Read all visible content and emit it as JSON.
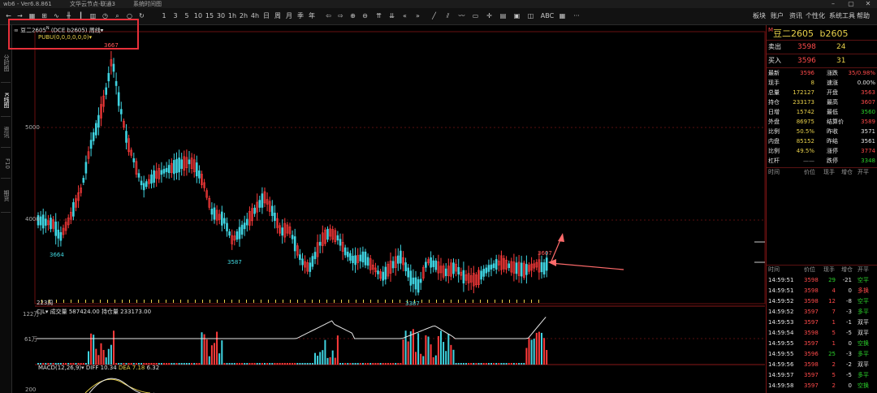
{
  "titlebar": {
    "app": "wb6 - Ver6.8.861",
    "tab1": "文华云节点-联通3",
    "tab2": "系统时间图"
  },
  "toolbar": {
    "icons": [
      "back-icon",
      "forward-icon",
      "table-icon",
      "grid-icon",
      "line-chart-icon",
      "candle-icon",
      "kline-icon",
      "bar-icon",
      "clock-icon",
      "circle-icon",
      "search-icon",
      "ring-icon",
      "refresh-icon"
    ],
    "periods": [
      "1",
      "3",
      "5",
      "10",
      "15",
      "30",
      "1h",
      "2h",
      "4h",
      "日",
      "周",
      "月",
      "季",
      "年"
    ],
    "menu_right": [
      "板块",
      "账户",
      "资讯",
      "个性化",
      "系统工具",
      "帮助"
    ],
    "abc": "ABC",
    "more": "···"
  },
  "left_tabs": [
    "分时图",
    "K线图",
    "资讯",
    "F10",
    "期货"
  ],
  "chart": {
    "symbol_label": "豆二2605",
    "symbol_sup": "N",
    "contract": "(DCE b2605)",
    "period": "周线",
    "indicator": "PUBU(0,0,0,0,0,0)",
    "price_ticks": [
      "5000",
      "4000"
    ],
    "high_label": "3667",
    "low_label1": "3664",
    "low_label2": "3587",
    "low_label3": "3387",
    "last_high_label": "3607",
    "bars_count": "223周",
    "vol_indicator": "CJL",
    "vol_text": "成交量 587424.00",
    "oi_text": "持仓量 233173.00",
    "vol_ticks": [
      "122万",
      "61万"
    ],
    "macd_label": "MACD(12,26,9)",
    "diff": "DIFF 10.34",
    "dea": "DEA 7.18",
    "macd_val": "6.32",
    "macd_tick": "200"
  },
  "quote": {
    "code_prefix": "M",
    "name": "豆二2605",
    "code": "b2605",
    "ask_label": "卖出",
    "ask_price": "3598",
    "ask_vol": "24",
    "bid_label": "买入",
    "bid_price": "3596",
    "bid_vol": "31",
    "grid": [
      {
        "l1": "最新",
        "v1": "3596",
        "c1": "red",
        "l2": "涨跌",
        "v2": "35/0.98%",
        "c2": "red"
      },
      {
        "l1": "现手",
        "v1": "8",
        "c1": "yellow",
        "l2": "速涨",
        "v2": "0.00%",
        "c2": "white"
      },
      {
        "l1": "总量",
        "v1": "172127",
        "c1": "yellow",
        "l2": "开盘",
        "v2": "3563",
        "c2": "red"
      },
      {
        "l1": "持仓",
        "v1": "233173",
        "c1": "yellow",
        "l2": "最高",
        "v2": "3607",
        "c2": "red"
      },
      {
        "l1": "日增",
        "v1": "15742",
        "c1": "yellow",
        "l2": "最低",
        "v2": "3560",
        "c2": "green"
      },
      {
        "l1": "外盘",
        "v1": "86975",
        "c1": "yellow",
        "l2": "结算价",
        "v2": "3589",
        "c2": "red"
      },
      {
        "l1": "比例",
        "v1": "50.5%",
        "c1": "yellow",
        "l2": "昨收",
        "v2": "3571",
        "c2": "white"
      },
      {
        "l1": "内盘",
        "v1": "85152",
        "c1": "yellow",
        "l2": "昨结",
        "v2": "3561",
        "c2": "white"
      },
      {
        "l1": "比例",
        "v1": "49.5%",
        "c1": "yellow",
        "l2": "涨停",
        "v2": "3774",
        "c2": "red"
      },
      {
        "l1": "杠杆",
        "v1": "——",
        "c1": "gray",
        "l2": "跌停",
        "v2": "3348",
        "c2": "green"
      }
    ],
    "tick_headers": [
      "时间",
      "价位",
      "现手",
      "增仓",
      "开平"
    ],
    "ticks": [
      {
        "t": "14:59:51",
        "p": "3598",
        "v": "29",
        "d": "-21",
        "o": "空平",
        "oc": "green"
      },
      {
        "t": "14:59:51",
        "p": "3598",
        "v": "4",
        "d": "0",
        "o": "多换",
        "oc": "red"
      },
      {
        "t": "14:59:52",
        "p": "3598",
        "v": "12",
        "d": "-8",
        "o": "空平",
        "oc": "green"
      },
      {
        "t": "14:59:52",
        "p": "3597",
        "v": "7",
        "d": "-3",
        "o": "多平",
        "oc": "green"
      },
      {
        "t": "14:59:53",
        "p": "3597",
        "v": "1",
        "d": "-1",
        "o": "双平",
        "oc": "white"
      },
      {
        "t": "14:59:54",
        "p": "3598",
        "v": "5",
        "d": "-5",
        "o": "双平",
        "oc": "white"
      },
      {
        "t": "14:59:55",
        "p": "3597",
        "v": "1",
        "d": "0",
        "o": "空换",
        "oc": "green"
      },
      {
        "t": "14:59:55",
        "p": "3596",
        "v": "25",
        "d": "-3",
        "o": "多平",
        "oc": "green"
      },
      {
        "t": "14:59:56",
        "p": "3598",
        "v": "2",
        "d": "-2",
        "o": "双平",
        "oc": "white"
      },
      {
        "t": "14:59:57",
        "p": "3597",
        "v": "5",
        "d": "-5",
        "o": "多平",
        "oc": "green"
      },
      {
        "t": "14:59:58",
        "p": "3597",
        "v": "2",
        "d": "0",
        "o": "空换",
        "oc": "green"
      }
    ]
  }
}
